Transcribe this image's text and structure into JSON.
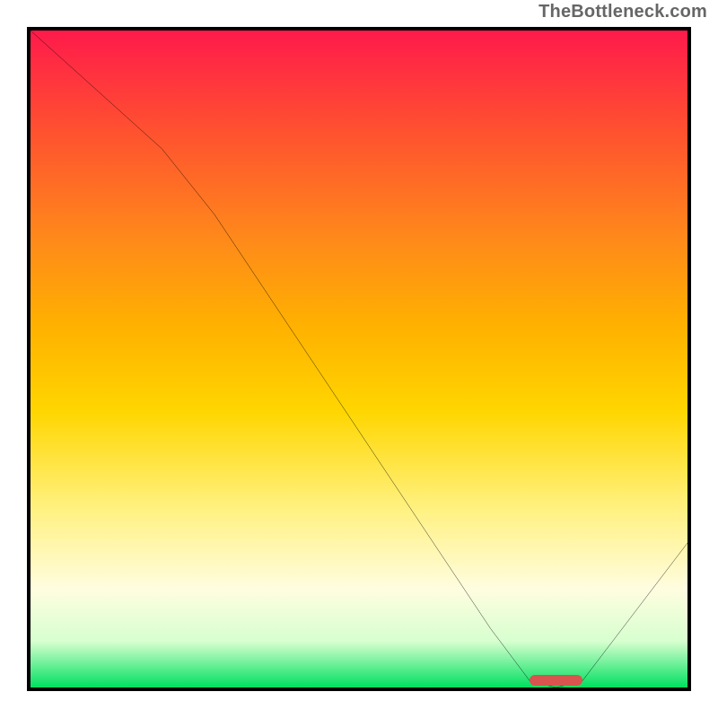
{
  "watermark": "TheBottleneck.com",
  "chart_data": {
    "type": "line",
    "title": "",
    "xlabel": "",
    "ylabel": "",
    "xlim": [
      0,
      100
    ],
    "ylim": [
      0,
      100
    ],
    "grid": false,
    "legend": null,
    "x": [
      0,
      10,
      20,
      28,
      40,
      50,
      60,
      70,
      76,
      80,
      84,
      100
    ],
    "values": [
      100,
      91,
      82,
      72,
      54,
      39,
      24,
      9,
      1,
      0,
      1,
      22
    ],
    "marker": {
      "x_start": 76,
      "x_end": 84,
      "y": 0
    },
    "gradient_stops": [
      {
        "pos": 0,
        "color": "#ff1a4b"
      },
      {
        "pos": 15,
        "color": "#ff5030"
      },
      {
        "pos": 32,
        "color": "#ff8a1a"
      },
      {
        "pos": 45,
        "color": "#ffb100"
      },
      {
        "pos": 58,
        "color": "#ffd600"
      },
      {
        "pos": 72,
        "color": "#fff07a"
      },
      {
        "pos": 85,
        "color": "#fffde0"
      },
      {
        "pos": 93,
        "color": "#d7ffcf"
      },
      {
        "pos": 100,
        "color": "#00e060"
      }
    ]
  }
}
